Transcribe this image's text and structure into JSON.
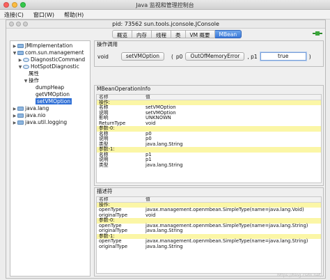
{
  "window": {
    "title": "Java 监视和管理控制台"
  },
  "menu": [
    "连接(C)",
    "窗口(W)",
    "帮助(H)"
  ],
  "inner": {
    "pid_title": "pid: 73562 sun.tools.jconsole.JConsole"
  },
  "tabs": [
    {
      "label": "概览",
      "active": false
    },
    {
      "label": "内存",
      "active": false
    },
    {
      "label": "线程",
      "active": false
    },
    {
      "label": "类",
      "active": false
    },
    {
      "label": "VM 概要",
      "active": false
    },
    {
      "label": "MBean",
      "active": true
    }
  ],
  "tree": [
    {
      "label": "JMImplementation",
      "expanded": false,
      "folder": true
    },
    {
      "label": "com.sun.management",
      "expanded": true,
      "folder": true
    },
    {
      "label": "DiagnosticCommand",
      "expanded": false,
      "folder": false
    },
    {
      "label": "HotSpotDiagnostic",
      "expanded": true,
      "folder": false
    },
    {
      "label": "属性",
      "expanded": false,
      "folder": false
    },
    {
      "label": "操作",
      "expanded": true,
      "folder": false
    },
    {
      "label": "dumpHeap",
      "leaf": true
    },
    {
      "label": "getVMOption",
      "leaf": true
    },
    {
      "label": "setVMOption",
      "leaf": true,
      "selected": true
    },
    {
      "label": "java.lang",
      "expanded": false,
      "folder": true
    },
    {
      "label": "java.nio",
      "expanded": false,
      "folder": true
    },
    {
      "label": "java.util.logging",
      "expanded": false,
      "folder": true
    }
  ],
  "operation": {
    "section_title": "操作调用",
    "return_type": "void",
    "button": "setVMOption",
    "paren_open": "(",
    "p0_label": "p0",
    "p0_value": "OutOfMemoryError",
    "sep": ", p1",
    "p1_value": "true",
    "paren_close": ")"
  },
  "info": {
    "section_title": "MBeanOperationInfo",
    "header": [
      "名称",
      "值"
    ],
    "rows": [
      {
        "k": "操作:",
        "v": "",
        "y": true
      },
      {
        "k": "名称",
        "v": "setVMOption"
      },
      {
        "k": "说明",
        "v": "setVMOption"
      },
      {
        "k": "影响",
        "v": "UNKNOWN"
      },
      {
        "k": "ReturnType",
        "v": "void"
      },
      {
        "k": "参数-0:",
        "v": "",
        "y": true
      },
      {
        "k": "名称",
        "v": "p0"
      },
      {
        "k": "说明",
        "v": "p0"
      },
      {
        "k": "类型",
        "v": "java.lang.String"
      },
      {
        "k": "参数-1:",
        "v": "",
        "y": true
      },
      {
        "k": "名称",
        "v": "p1"
      },
      {
        "k": "说明",
        "v": "p1"
      },
      {
        "k": "类型",
        "v": "java.lang.String"
      }
    ]
  },
  "desc": {
    "section_title": "描述符",
    "header": [
      "名称",
      "值"
    ],
    "rows": [
      {
        "k": "操作:",
        "v": "",
        "y": true
      },
      {
        "k": "openType",
        "v": "javax.management.openmbean.SimpleType(name=java.lang.Void)"
      },
      {
        "k": "originalType",
        "v": "void"
      },
      {
        "k": "参数-0:",
        "v": "",
        "y": true
      },
      {
        "k": "openType",
        "v": "javax.management.openmbean.SimpleType(name=java.lang.String)"
      },
      {
        "k": "originalType",
        "v": "java.lang.String"
      },
      {
        "k": "参数-1:",
        "v": "",
        "y": true
      },
      {
        "k": "openType",
        "v": "javax.management.openmbean.SimpleType(name=java.lang.String)"
      },
      {
        "k": "originalType",
        "v": "java.lang.String"
      }
    ]
  },
  "watermark": "https://blog.csdn.net/..."
}
